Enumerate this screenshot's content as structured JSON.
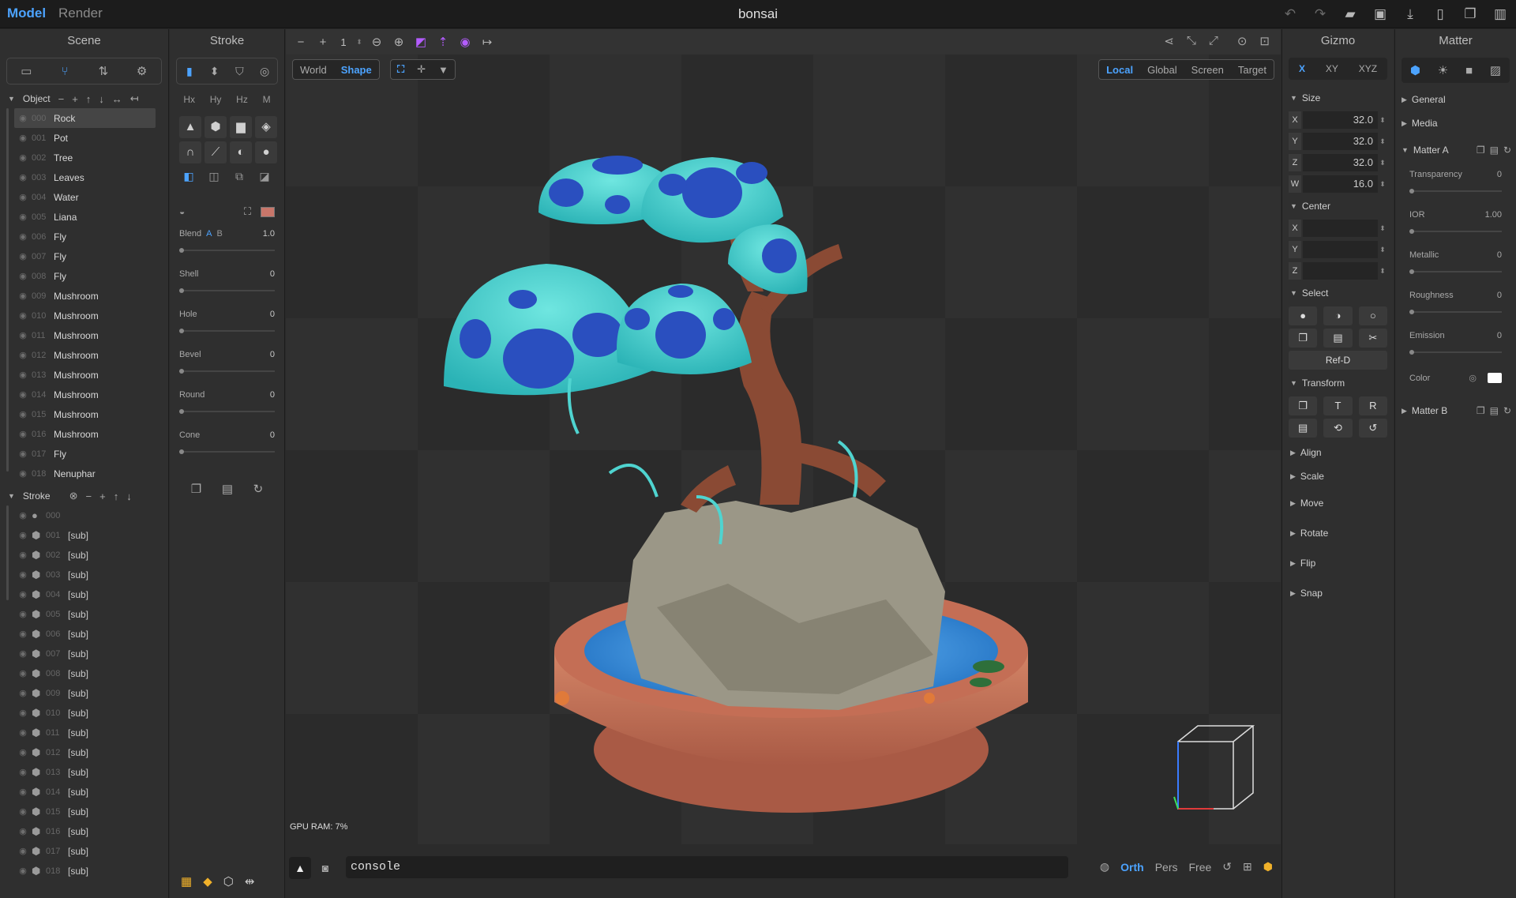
{
  "topbar": {
    "mode_model": "Model",
    "mode_render": "Render",
    "title": "bonsai",
    "icons": [
      "undo-icon",
      "redo-icon",
      "open-folder-icon",
      "save-icon",
      "download-icon",
      "new-file-icon",
      "duplicate-icon",
      "trash-icon"
    ]
  },
  "scene": {
    "title": "Scene",
    "object_section": "Object",
    "objects": [
      {
        "num": "000",
        "name": "Rock"
      },
      {
        "num": "001",
        "name": "Pot"
      },
      {
        "num": "002",
        "name": "Tree"
      },
      {
        "num": "003",
        "name": "Leaves"
      },
      {
        "num": "004",
        "name": "Water"
      },
      {
        "num": "005",
        "name": "Liana"
      },
      {
        "num": "006",
        "name": "Fly"
      },
      {
        "num": "007",
        "name": "Fly"
      },
      {
        "num": "008",
        "name": "Fly"
      },
      {
        "num": "009",
        "name": "Mushroom"
      },
      {
        "num": "010",
        "name": "Mushroom"
      },
      {
        "num": "011",
        "name": "Mushroom"
      },
      {
        "num": "012",
        "name": "Mushroom"
      },
      {
        "num": "013",
        "name": "Mushroom"
      },
      {
        "num": "014",
        "name": "Mushroom"
      },
      {
        "num": "015",
        "name": "Mushroom"
      },
      {
        "num": "016",
        "name": "Mushroom"
      },
      {
        "num": "017",
        "name": "Fly"
      },
      {
        "num": "018",
        "name": "Nenuphar"
      }
    ],
    "selected_index": 0,
    "stroke_section": "Stroke",
    "strokes": [
      {
        "num": "000",
        "name": ""
      },
      {
        "num": "001",
        "name": "[sub]"
      },
      {
        "num": "002",
        "name": "[sub]"
      },
      {
        "num": "003",
        "name": "[sub]"
      },
      {
        "num": "004",
        "name": "[sub]"
      },
      {
        "num": "005",
        "name": "[sub]"
      },
      {
        "num": "006",
        "name": "[sub]"
      },
      {
        "num": "007",
        "name": "[sub]"
      },
      {
        "num": "008",
        "name": "[sub]"
      },
      {
        "num": "009",
        "name": "[sub]"
      },
      {
        "num": "010",
        "name": "[sub]"
      },
      {
        "num": "011",
        "name": "[sub]"
      },
      {
        "num": "012",
        "name": "[sub]"
      },
      {
        "num": "013",
        "name": "[sub]"
      },
      {
        "num": "014",
        "name": "[sub]"
      },
      {
        "num": "015",
        "name": "[sub]"
      },
      {
        "num": "016",
        "name": "[sub]"
      },
      {
        "num": "017",
        "name": "[sub]"
      },
      {
        "num": "018",
        "name": "[sub]"
      }
    ]
  },
  "stroke": {
    "title": "Stroke",
    "hx": "Hx",
    "hy": "Hy",
    "hz": "Hz",
    "m": "M",
    "blend_label": "Blend",
    "blend_a": "A",
    "blend_b": "B",
    "blend_value": "1.0",
    "props": [
      {
        "label": "Shell",
        "value": "0"
      },
      {
        "label": "Hole",
        "value": "0"
      },
      {
        "label": "Bevel",
        "value": "0"
      },
      {
        "label": "Round",
        "value": "0"
      },
      {
        "label": "Cone",
        "value": "0"
      }
    ]
  },
  "viewport": {
    "step_value": "1",
    "world": "World",
    "shape": "Shape",
    "local": "Local",
    "global": "Global",
    "screen": "Screen",
    "target": "Target",
    "gpu_ram": "GPU RAM:  7%",
    "console_value": "console",
    "orth": "Orth",
    "pers": "Pers",
    "free": "Free"
  },
  "gizmo": {
    "title": "Gizmo",
    "tab_x": "X",
    "tab_xy": "XY",
    "tab_xyz": "XYZ",
    "size_label": "Size",
    "size": [
      {
        "axis": "X",
        "value": "32.0"
      },
      {
        "axis": "Y",
        "value": "32.0"
      },
      {
        "axis": "Z",
        "value": "32.0"
      },
      {
        "axis": "W",
        "value": "16.0"
      }
    ],
    "center_label": "Center",
    "center": [
      {
        "axis": "X",
        "value": ""
      },
      {
        "axis": "Y",
        "value": ""
      },
      {
        "axis": "Z",
        "value": ""
      }
    ],
    "select_label": "Select",
    "ref_d": "Ref-D",
    "transform_label": "Transform",
    "t_btn": "T",
    "r_btn": "R",
    "align": "Align",
    "scale": "Scale",
    "move": "Move",
    "rotate": "Rotate",
    "flip": "Flip",
    "snap": "Snap"
  },
  "matter": {
    "title": "Matter",
    "general": "General",
    "media": "Media",
    "matter_a": "Matter A",
    "props": [
      {
        "label": "Transparency",
        "value": "0"
      },
      {
        "label": "IOR",
        "value": "1.00"
      },
      {
        "label": "Metallic",
        "value": "0"
      },
      {
        "label": "Roughness",
        "value": "0"
      },
      {
        "label": "Emission",
        "value": "0"
      }
    ],
    "color_label": "Color",
    "color_value": "#ffffff",
    "matter_b": "Matter B"
  },
  "colors": {
    "accent": "#4ca3ff",
    "purple": "#b45cff",
    "mushroom_cap": "#3fc9c7",
    "mushroom_spot": "#2a4fbf",
    "trunk": "#8a4a34",
    "rock": "#9b9787",
    "pot": "#c7735a",
    "water": "#2f8ed6"
  }
}
